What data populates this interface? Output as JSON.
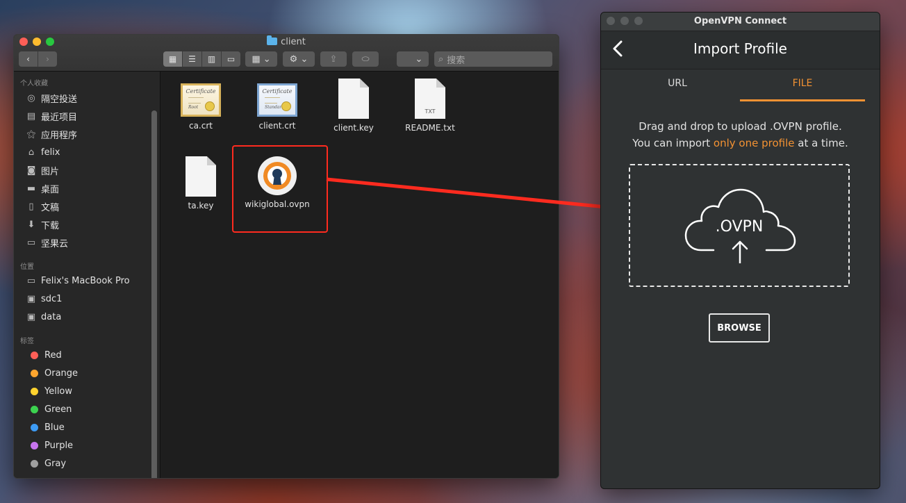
{
  "finder": {
    "title": "client",
    "search_placeholder": "搜索",
    "sidebar": {
      "favorites_title": "个人收藏",
      "favorites": [
        {
          "label": "隔空投送",
          "icon": "airdrop-icon"
        },
        {
          "label": "最近项目",
          "icon": "recents-icon"
        },
        {
          "label": "应用程序",
          "icon": "applications-icon"
        },
        {
          "label": "felix",
          "icon": "home-icon"
        },
        {
          "label": "图片",
          "icon": "pictures-icon"
        },
        {
          "label": "桌面",
          "icon": "desktop-icon"
        },
        {
          "label": "文稿",
          "icon": "documents-icon"
        },
        {
          "label": "下载",
          "icon": "downloads-icon"
        },
        {
          "label": "坚果云",
          "icon": "folder-icon"
        }
      ],
      "locations_title": "位置",
      "locations": [
        {
          "label": "Felix's MacBook Pro",
          "icon": "laptop-icon"
        },
        {
          "label": "sdc1",
          "icon": "drive-icon"
        },
        {
          "label": "data",
          "icon": "drive-icon"
        }
      ],
      "tags_title": "标签",
      "tags": [
        {
          "label": "Red",
          "color": "#fe5f57"
        },
        {
          "label": "Orange",
          "color": "#fea52e"
        },
        {
          "label": "Yellow",
          "color": "#fed22e"
        },
        {
          "label": "Green",
          "color": "#3cd24f"
        },
        {
          "label": "Blue",
          "color": "#3d9bf4"
        },
        {
          "label": "Purple",
          "color": "#c774ee"
        },
        {
          "label": "Gray",
          "color": "#a0a0a0"
        }
      ]
    },
    "files": [
      {
        "name": "ca.crt",
        "icon": "certificate-icon"
      },
      {
        "name": "client.crt",
        "icon": "certificate-icon"
      },
      {
        "name": "client.key",
        "icon": "document-icon"
      },
      {
        "name": "README.txt",
        "icon": "text-document-icon",
        "badge": "TXT"
      },
      {
        "name": "ta.key",
        "icon": "document-icon"
      },
      {
        "name": "wikiglobal.ovpn",
        "icon": "openvpn-file-icon"
      }
    ],
    "cert_text": [
      "Certificate",
      "Certificate"
    ],
    "cert_sub": [
      "Root",
      "Standard"
    ]
  },
  "openvpn": {
    "window_title": "OpenVPN Connect",
    "heading": "Import Profile",
    "tabs": [
      {
        "label": "URL"
      },
      {
        "label": "FILE"
      }
    ],
    "message_line1": "Drag and drop to upload .OVPN profile.",
    "message_line2_prefix": "You can import ",
    "message_line2_highlight": "only one profile",
    "message_line2_suffix": " at a time.",
    "drop_label": ".OVPN",
    "browse_label": "BROWSE",
    "accent_color": "#f39233"
  },
  "annotation": {
    "highlight_color": "#ff2b1f"
  }
}
